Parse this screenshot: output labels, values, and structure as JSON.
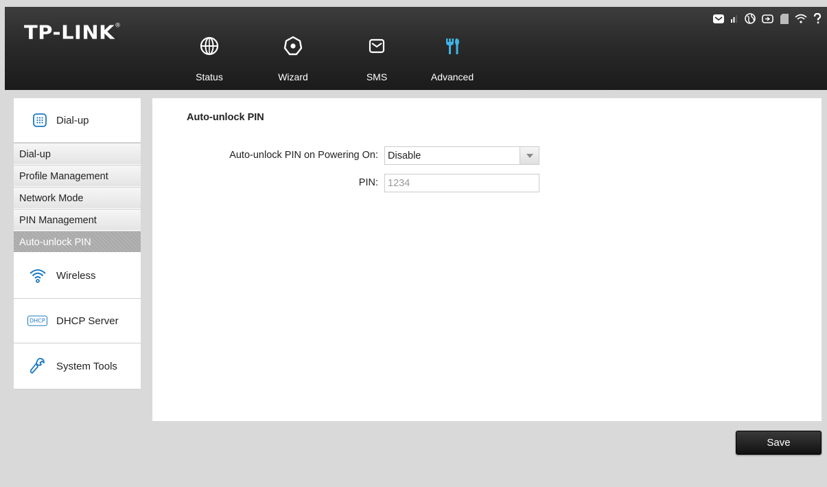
{
  "brand": {
    "logo_text": "TP-LINK",
    "registered": "®"
  },
  "nav": [
    {
      "label": "Status",
      "icon": "globe-icon"
    },
    {
      "label": "Wizard",
      "icon": "gear-icon"
    },
    {
      "label": "SMS",
      "icon": "envelope-icon"
    },
    {
      "label": "Advanced",
      "icon": "tools-icon",
      "accent": "#3fb5e8"
    }
  ],
  "status_bar": [
    "sms-icon",
    "signal-icon",
    "internet-icon",
    "battery-icon",
    "sd-card-icon",
    "wifi-icon",
    "help-icon"
  ],
  "sidebar": {
    "dialup_group": {
      "label": "Dial-up",
      "icon": "keypad-icon"
    },
    "dialup_items": [
      {
        "label": "Dial-up"
      },
      {
        "label": "Profile Management"
      },
      {
        "label": "Network Mode"
      },
      {
        "label": "PIN Management"
      },
      {
        "label": "Auto-unlock PIN",
        "active": true
      }
    ],
    "wireless_group": {
      "label": "Wireless",
      "icon": "wifi-icon"
    },
    "dhcp_group": {
      "label": "DHCP Server",
      "icon": "dhcp-icon",
      "icon_text": "DHCP"
    },
    "tools_group": {
      "label": "System Tools",
      "icon": "wrench-icon"
    }
  },
  "main": {
    "title": "Auto-unlock PIN",
    "power_on_label": "Auto-unlock PIN on Powering On:",
    "power_on_value": "Disable",
    "pin_label": "PIN:",
    "pin_value": "1234"
  },
  "actions": {
    "save_label": "Save"
  },
  "colors": {
    "header_bg": "#1f1f1f",
    "accent": "#3fb5e8",
    "sidebar_active": "#ababab"
  }
}
